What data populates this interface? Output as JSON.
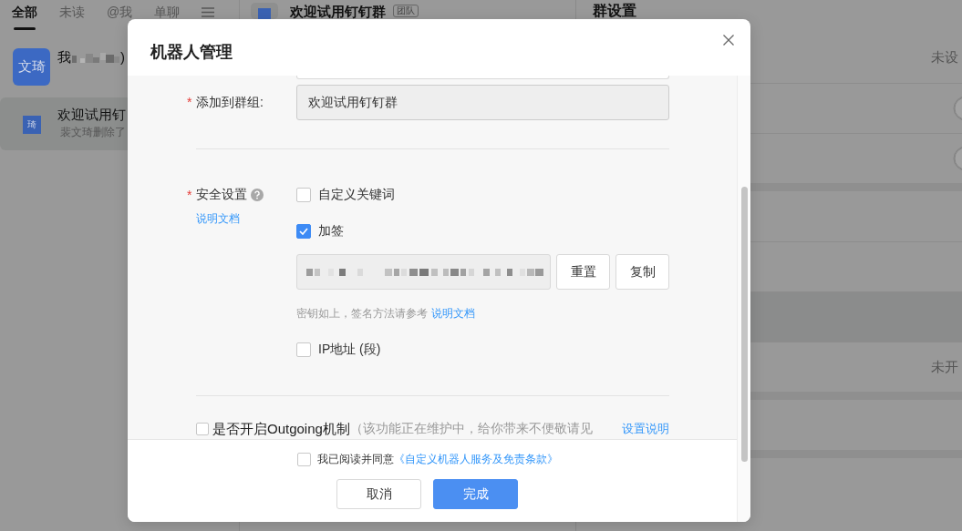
{
  "chat_list": {
    "tabs": [
      {
        "label": "全部",
        "selected": true
      },
      {
        "label": "未读",
        "selected": false
      },
      {
        "label": "@我",
        "selected": false
      },
      {
        "label": "单聊",
        "selected": false
      }
    ],
    "items": [
      {
        "kind": "person",
        "avatar": "文琦",
        "name": "我",
        "name_redacted": true,
        "name_end": ")",
        "selected": false
      },
      {
        "kind": "group",
        "avatar": "琦",
        "name": "欢迎试用钉",
        "name_redacted": false,
        "preview": "裴文琦删除了",
        "selected": true
      }
    ]
  },
  "chat_header": {
    "title": "欢迎试用钉钉群",
    "badge": "团队"
  },
  "group_settings": {
    "title": "群设置",
    "sections": [
      {
        "rows": [
          {
            "kind": "value",
            "value": "未设"
          },
          {
            "kind": "toggle",
            "on": false
          },
          {
            "kind": "toggle",
            "on": false
          }
        ]
      },
      {
        "rows": [
          {
            "kind": "blank"
          },
          {
            "kind": "blank"
          },
          {
            "kind": "band"
          },
          {
            "kind": "value",
            "value": "未开"
          }
        ]
      },
      {
        "rows": [
          {
            "kind": "blank"
          }
        ]
      },
      {
        "rows": [
          {
            "kind": "blank"
          }
        ]
      }
    ]
  },
  "dialog": {
    "title": "机器人管理",
    "group_field": {
      "required_mark": "*",
      "label": "添加到群组:",
      "value": "欢迎试用钉钉群",
      "disabled": true
    },
    "security": {
      "required_mark": "*",
      "label": "安全设置",
      "doc_link": "说明文档",
      "options": [
        {
          "kind": "checkbox",
          "label": "自定义关键词",
          "checked": false
        },
        {
          "kind": "checkbox",
          "label": "加签",
          "checked": true
        },
        {
          "kind": "secret",
          "value_redacted": true,
          "buttons": [
            "重置",
            "复制"
          ]
        },
        {
          "kind": "hint",
          "text": "密钥如上，签名方法请参考",
          "link": "说明文档"
        },
        {
          "kind": "checkbox",
          "label": "IP地址 (段)",
          "checked": false
        }
      ]
    },
    "outgoing": {
      "checked": false,
      "label": "是否开启Outgoing机制",
      "note": "（该功能正在维护中，给你带来不便敬请见",
      "link": "设置说明"
    },
    "agreement": {
      "checked": false,
      "text": "我已阅读并同意",
      "link": "《自定义机器人服务及免责条款》"
    },
    "buttons": [
      {
        "label": "取消",
        "kind": "default"
      },
      {
        "label": "完成",
        "kind": "primary"
      }
    ]
  }
}
